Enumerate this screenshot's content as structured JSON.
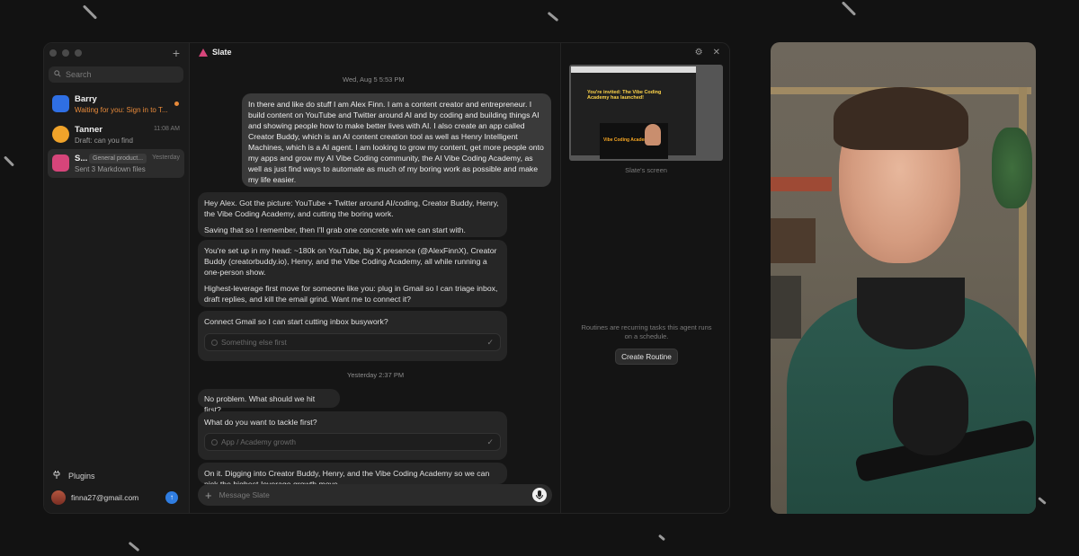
{
  "sidebar": {
    "search_placeholder": "Search",
    "new_label": "+",
    "conversations": [
      {
        "name": "Barry",
        "preview": "Waiting for you: Sign in to T...",
        "time": "",
        "unread": true,
        "avatar_color": "#2f6fe4"
      },
      {
        "name": "Tanner",
        "preview": "Draft: can you find",
        "time": "11:08 AM",
        "unread": false,
        "avatar_color": "#f0a32a"
      },
      {
        "name": "S...",
        "tag": "General product...",
        "preview": "Sent 3 Markdown files",
        "time": "Yesterday",
        "unread": false,
        "avatar_color": "#d6457a"
      }
    ],
    "plugins_label": "Plugins",
    "user_email": "finna27@gmail.com"
  },
  "chat": {
    "title": "Slate",
    "timestamp_1": "Wed, Aug 5 5:53 PM",
    "user_message": "In there and like do stuff I am Alex Finn. I am a content creator and entrepreneur. I build content on YouTube and Twitter around AI and by coding and building things AI and showing people how to make better lives with AI. I also create an app called Creator Buddy, which is an AI content creation tool as well as Henry Intelligent Machines, which is a AI agent. I am looking to grow my content, get more people onto my apps and grow my AI Vibe Coding community, the AI Vibe Coding Academy, as well as just find ways to automate as much of my boring work as possible and make my life easier.",
    "bot_1_p1": "Hey Alex. Got the picture: YouTube + Twitter around AI/coding, Creator Buddy, Henry, the Vibe Coding Academy, and cutting the boring work.",
    "bot_1_p2": "Saving that so I remember, then I'll grab one concrete win we can start with.",
    "bot_2_p1": "You're set up in my head: ~180k on YouTube, big X presence (@AlexFinnX), Creator Buddy (creatorbuddy.io), Henry, and the Vibe Coding Academy, all while running a one-person show.",
    "bot_2_p2": "Highest-leverage first move for someone like you: plug in Gmail so I can triage inbox, draft replies, and kill the email grind. Want me to connect it?",
    "question_1": "Connect Gmail so I can start cutting inbox busywork?",
    "choice_1": "Something else first",
    "timestamp_2": "Yesterday 2:37 PM",
    "bot_3": "No problem. What should we hit first?",
    "question_2": "What do you want to tackle first?",
    "choice_2": "App / Academy growth",
    "bot_4": "On it. Digging into Creator Buddy, Henry, and the Vibe Coding Academy so we can pick the highest-leverage growth move.",
    "composer_placeholder": "Message Slate"
  },
  "panel": {
    "screen_title": "You're invited: The Vibe Coding Academy has launched!",
    "screen_banner": "Vibe Coding Academy",
    "screen_caption": "Slate's screen",
    "routines_text": "Routines are recurring tasks this agent runs on a schedule.",
    "create_routine": "Create Routine"
  },
  "colors": {
    "accent_orange": "#e88a3a",
    "brand_pink": "#d6457a"
  }
}
